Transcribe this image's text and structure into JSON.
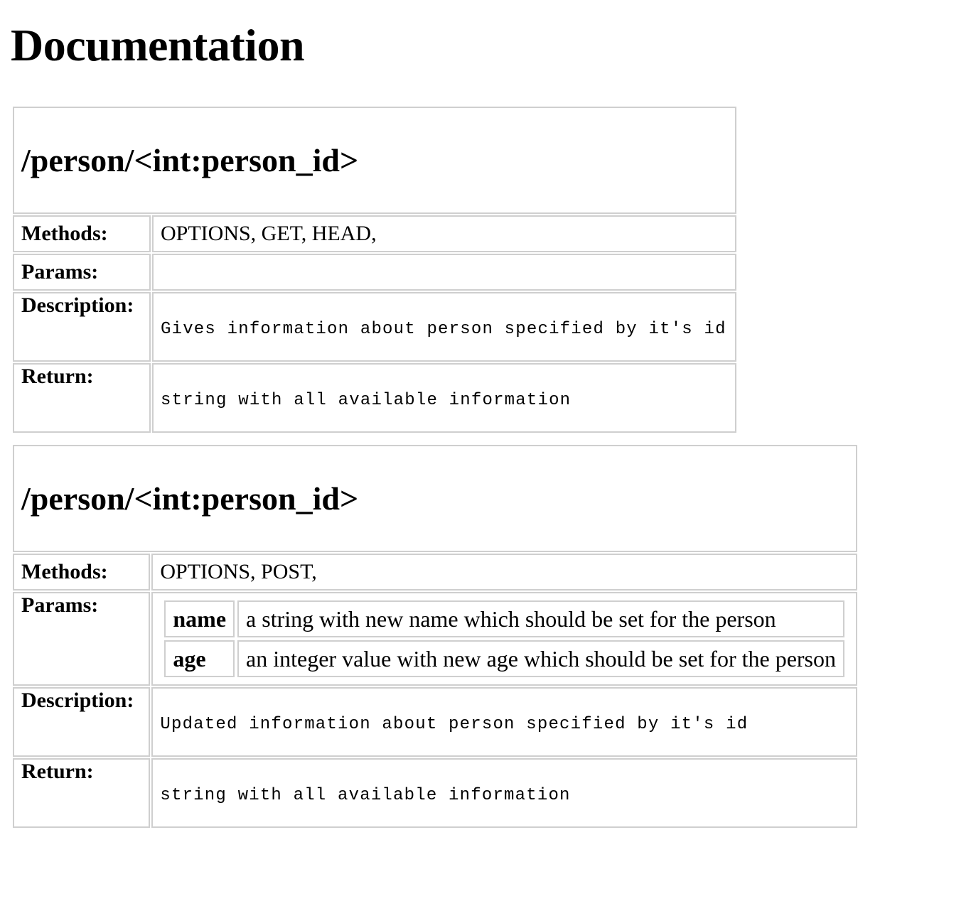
{
  "page": {
    "title": "Documentation"
  },
  "labels": {
    "methods": "Methods:",
    "params": "Params:",
    "description": "Description:",
    "return": "Return:"
  },
  "endpoints": [
    {
      "route": "/person/<int:person_id>",
      "methods": "OPTIONS, GET, HEAD,",
      "params": [],
      "description": "Gives information about person specified by it's id",
      "return": "string with all available information"
    },
    {
      "route": "/person/<int:person_id>",
      "methods": "OPTIONS, POST,",
      "params": [
        {
          "name": "name",
          "description": "a string with new name which should be set for the person"
        },
        {
          "name": "age",
          "description": "an integer value with new age which should be set for the person"
        }
      ],
      "description": "Updated information about person specified by it's id",
      "return": "string with all available information"
    }
  ]
}
